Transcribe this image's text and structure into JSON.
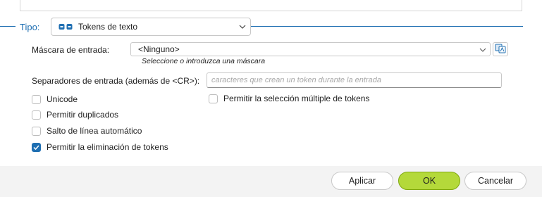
{
  "tipo": {
    "label": "Tipo:",
    "selected": "Tokens de texto",
    "icon": "token-icon"
  },
  "mask": {
    "label": "Máscara de entrada:",
    "value": "<Ninguno>",
    "hint": "Seleccione o introduzca una máscara",
    "button_icon": "mask-editor-icon"
  },
  "separators": {
    "label": "Separadores de entrada (además de <CR>):",
    "value": "",
    "placeholder": "caracteres que crean un token durante la entrada"
  },
  "options": {
    "unicode": {
      "label": "Unicode",
      "checked": false
    },
    "duplicates": {
      "label": "Permitir duplicados",
      "checked": false
    },
    "word_wrap": {
      "label": "Salto de línea automático",
      "checked": false
    },
    "delete_tokens": {
      "label": "Permitir la eliminación de tokens",
      "checked": true
    },
    "multi_select": {
      "label": "Permitir la selección múltiple de tokens",
      "checked": false
    }
  },
  "buttons": {
    "apply": "Aplicar",
    "ok": "OK",
    "cancel": "Cancelar"
  },
  "colors": {
    "accent": "#1f6fb2",
    "ok_button": "#b4d93a"
  }
}
